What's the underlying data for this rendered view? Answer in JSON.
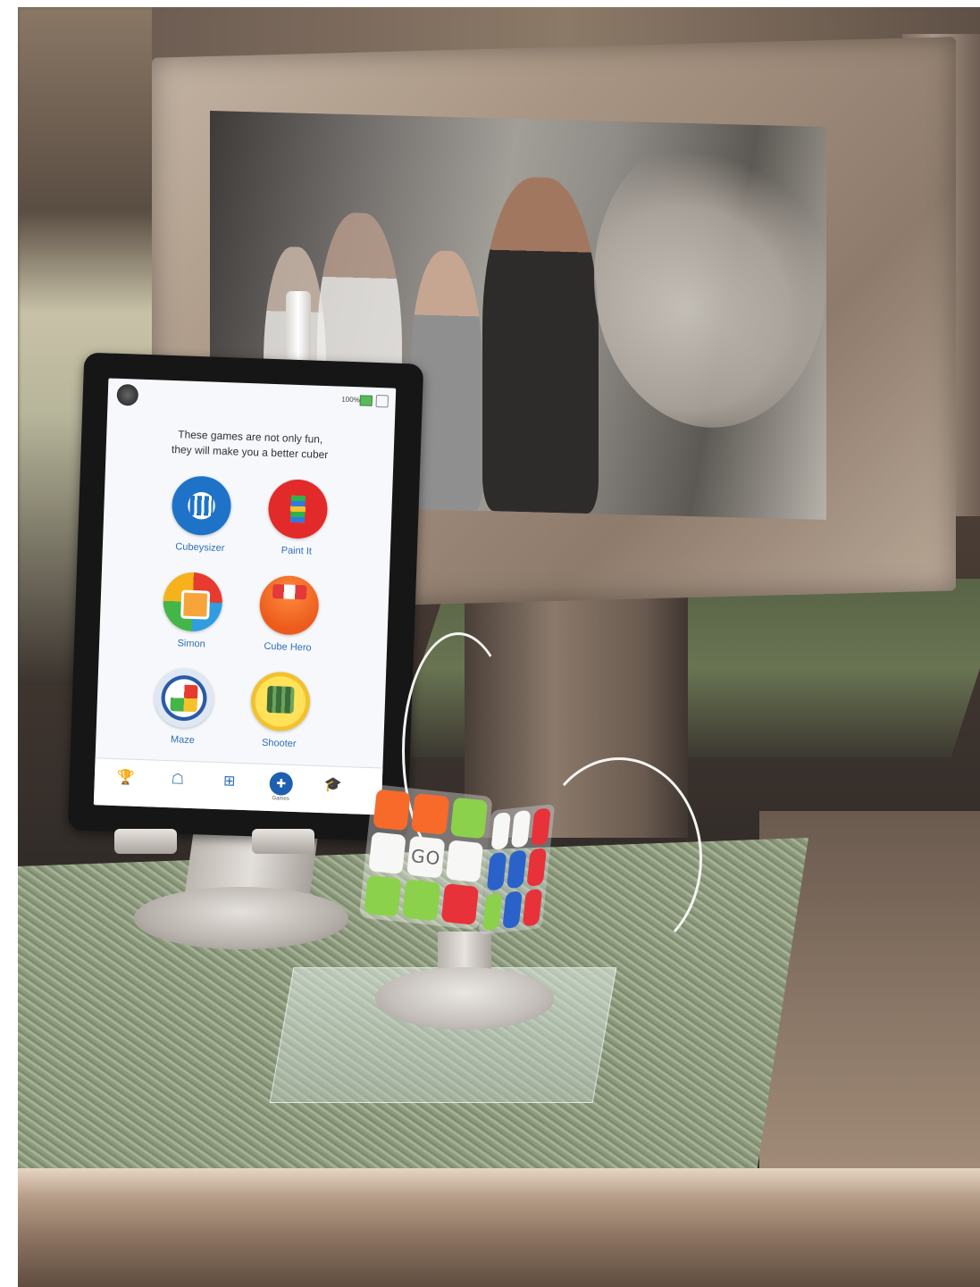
{
  "tablet_app": {
    "status": {
      "battery": "100%"
    },
    "headline": {
      "line1": "These games are not only fun,",
      "line2": "they will make you a better cuber"
    },
    "games": [
      {
        "label": "Cubeysizer",
        "icon": "cubeysizer-icon"
      },
      {
        "label": "Paint It",
        "icon": "paint-it-icon"
      },
      {
        "label": "Simon",
        "icon": "simon-icon"
      },
      {
        "label": "Cube Hero",
        "icon": "cube-hero-icon"
      },
      {
        "label": "Maze",
        "icon": "maze-icon"
      },
      {
        "label": "Shooter",
        "icon": "shooter-icon"
      }
    ],
    "tabs": [
      {
        "icon": "trophy-icon",
        "symbol": "🏆"
      },
      {
        "icon": "tips-icon",
        "symbol": "☖"
      },
      {
        "icon": "cube-icon",
        "symbol": "⊞"
      },
      {
        "icon": "gamepad-icon",
        "symbol": "✚",
        "label": "Games",
        "active": true
      },
      {
        "icon": "graduation-cap-icon",
        "symbol": "🎓"
      }
    ]
  },
  "cube": {
    "logo": "GO"
  },
  "colors": {
    "accent_blue": "#2f6fb5",
    "active_tab": "#1e5fb0",
    "cube_orange": "#f76a2a",
    "cube_green": "#8cd14b",
    "cube_red": "#e8323a",
    "cube_white": "#f7f7f5",
    "cube_blue": "#2a62c9",
    "cube_yellow": "#f6d22a"
  }
}
